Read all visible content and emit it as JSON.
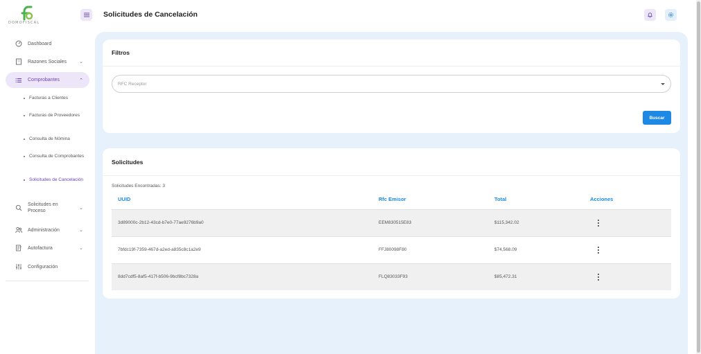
{
  "brand": {
    "logo_text": "DOMOFISCAL",
    "colors": {
      "primary": "#1e88e5",
      "accent": "#6a3fb8",
      "logo": "#4caf50"
    }
  },
  "header": {
    "title": "Solicitudes de Cancelación",
    "bell_icon": "bell-icon",
    "settings_icon": "gear-icon"
  },
  "sidebar": {
    "items": [
      {
        "label": "Dashboard",
        "icon": "dashboard-icon"
      },
      {
        "label": "Razones Sociales",
        "icon": "building-icon"
      },
      {
        "label": "Comprobantes",
        "icon": "list-icon"
      },
      {
        "label": "Solicitudes en Proceso",
        "icon": "search-icon"
      },
      {
        "label": "Administración",
        "icon": "users-icon"
      },
      {
        "label": "Autofactura",
        "icon": "invoice-icon"
      },
      {
        "label": "Configuración",
        "icon": "sliders-icon"
      }
    ],
    "subitems": [
      {
        "label": "Facturas a Clientes"
      },
      {
        "label": "Facturas de Proveedores"
      },
      {
        "label": "Consulta de Nómina"
      },
      {
        "label": "Consulta de Comprobantes"
      },
      {
        "label": "Solicitudes de Cancelación"
      }
    ]
  },
  "filters": {
    "title": "Filtros",
    "rfc_receptor_placeholder": "RFC Receptor",
    "search_label": "Buscar"
  },
  "requests": {
    "title": "Solicitudes",
    "found_text": "Solicitudes Encontradas: 3",
    "columns": [
      "UUID",
      "Rfc Emisor",
      "Total",
      "Acciones"
    ],
    "rows": [
      {
        "uuid": "3d89000c-2b12-43cd-b7e0-77ae9276b9a0",
        "rfc": "EEM830515E83",
        "total": "$115,342.02"
      },
      {
        "uuid": "7bfdc19f-7359-467d-a2ed-a835c8c1a2e9",
        "rfc": "FFJ80098F80",
        "total": "$74,568.09"
      },
      {
        "uuid": "8dd7cdf5-8af5-417f-b506-9bcf8bc7328a",
        "rfc": "FLQ83033F93",
        "total": "$85,472.31"
      }
    ]
  }
}
